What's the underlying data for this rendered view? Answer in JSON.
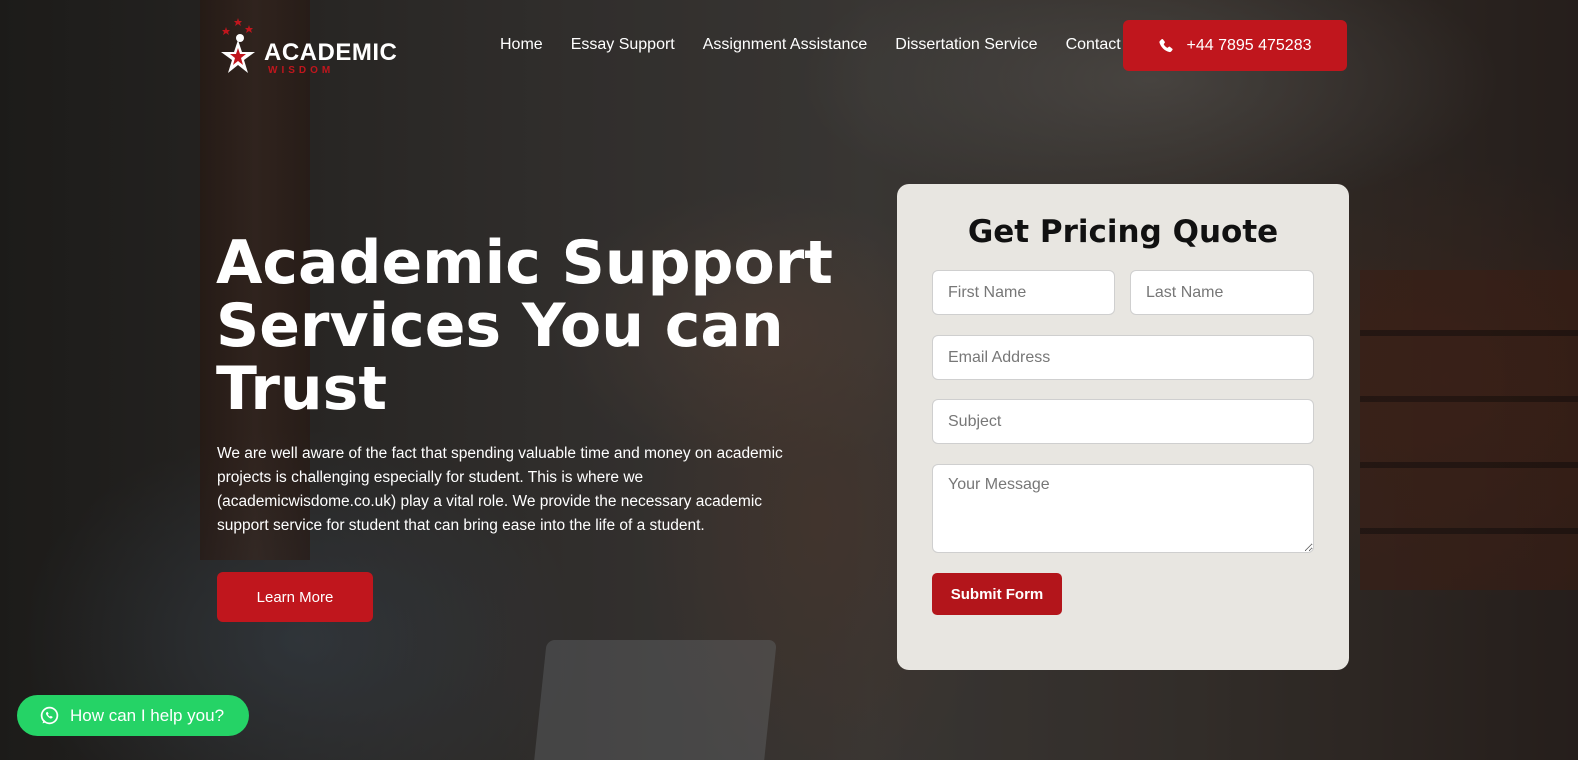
{
  "brand": {
    "name": "ACADEMIC",
    "tagline": "WISDOM"
  },
  "nav": {
    "items": [
      "Home",
      "Essay Support",
      "Assignment Assistance",
      "Dissertation Service",
      "Contact"
    ]
  },
  "phone": {
    "icon": "phone-icon",
    "number": "+44 7895 475283"
  },
  "hero": {
    "title": "Academic Support Services You can Trust",
    "text": "We are well aware of the fact that spending valuable time and money on academic projects is challenging especially for student. This is where we (academicwisdome.co.uk) play a vital role. We provide the necessary academic support service for student that can bring ease into the life of a student.",
    "cta": "Learn More"
  },
  "form": {
    "title": "Get Pricing Quote",
    "first_name_placeholder": "First Name",
    "last_name_placeholder": "Last Name",
    "email_placeholder": "Email Address",
    "subject_placeholder": "Subject",
    "message_placeholder": "Your Message",
    "submit": "Submit Form"
  },
  "chat": {
    "icon": "whatsapp-icon",
    "label": "How can I help you?"
  },
  "colors": {
    "accent": "#c0161d",
    "whatsapp": "#25d366",
    "card_bg": "#e8e6e1"
  }
}
